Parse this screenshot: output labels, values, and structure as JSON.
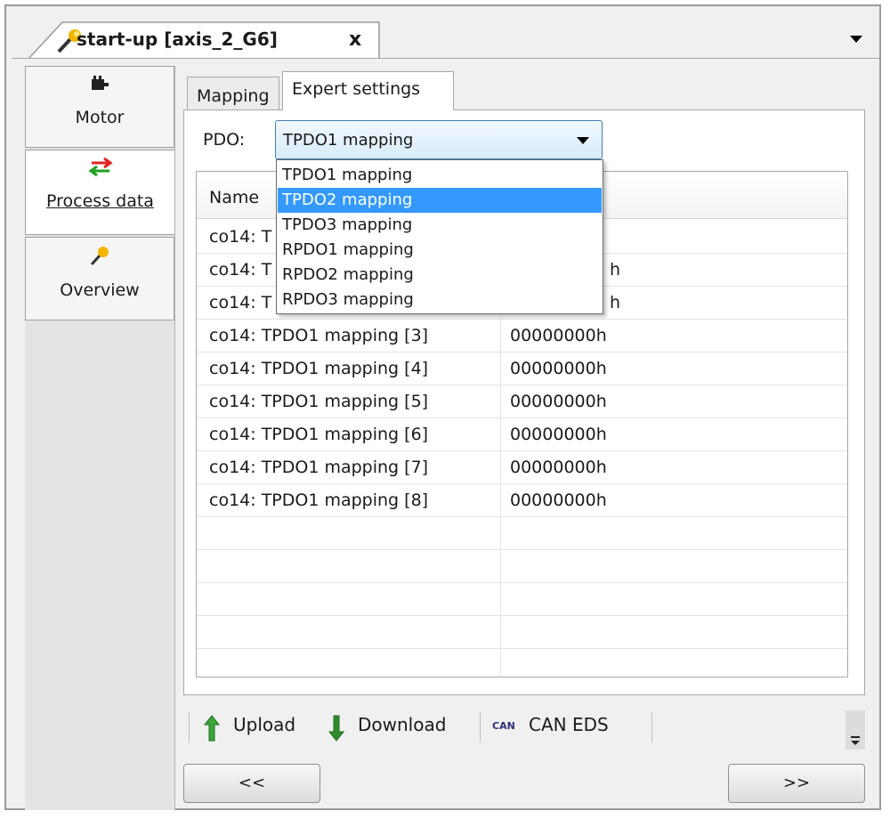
{
  "document_tab": {
    "title": "start-up [axis_2_G6]",
    "close": "x"
  },
  "side_nav": [
    {
      "label": "Motor",
      "icon": "motor-icon"
    },
    {
      "label": "Process data",
      "icon": "transfer-arrows-icon"
    },
    {
      "label": "Overview",
      "icon": "wizard-wand-icon"
    }
  ],
  "tabs": [
    {
      "label": "Mapping"
    },
    {
      "label": "Expert settings"
    }
  ],
  "pdo": {
    "label": "PDO:",
    "selected": "TPDO1 mapping",
    "options": [
      "TPDO1 mapping",
      "TPDO2 mapping",
      "TPDO3 mapping",
      "RPDO1  mapping",
      "RPDO2  mapping",
      "RPDO3  mapping"
    ],
    "highlighted": "TPDO2 mapping"
  },
  "grid": {
    "header": "Name",
    "rows": [
      {
        "name": "co14: T",
        "value": ""
      },
      {
        "name": "co14: T",
        "value": "h"
      },
      {
        "name": "co14: T",
        "value": "h"
      },
      {
        "name": "co14: TPDO1 mapping [3]",
        "value": "00000000h"
      },
      {
        "name": "co14: TPDO1 mapping [4]",
        "value": "00000000h"
      },
      {
        "name": "co14: TPDO1 mapping [5]",
        "value": "00000000h"
      },
      {
        "name": "co14: TPDO1 mapping [6]",
        "value": "00000000h"
      },
      {
        "name": "co14: TPDO1 mapping [7]",
        "value": "00000000h"
      },
      {
        "name": "co14: TPDO1 mapping [8]",
        "value": "00000000h"
      }
    ]
  },
  "toolbar": {
    "upload": "Upload",
    "download": "Download",
    "can_badge": "CAN",
    "can_eds": "CAN EDS"
  },
  "nav": {
    "prev": "<<",
    "next": ">>"
  },
  "colors": {
    "selection": "#3399ff",
    "upload_arrow": "#3aa63a",
    "download_arrow": "#2e8b2e"
  }
}
